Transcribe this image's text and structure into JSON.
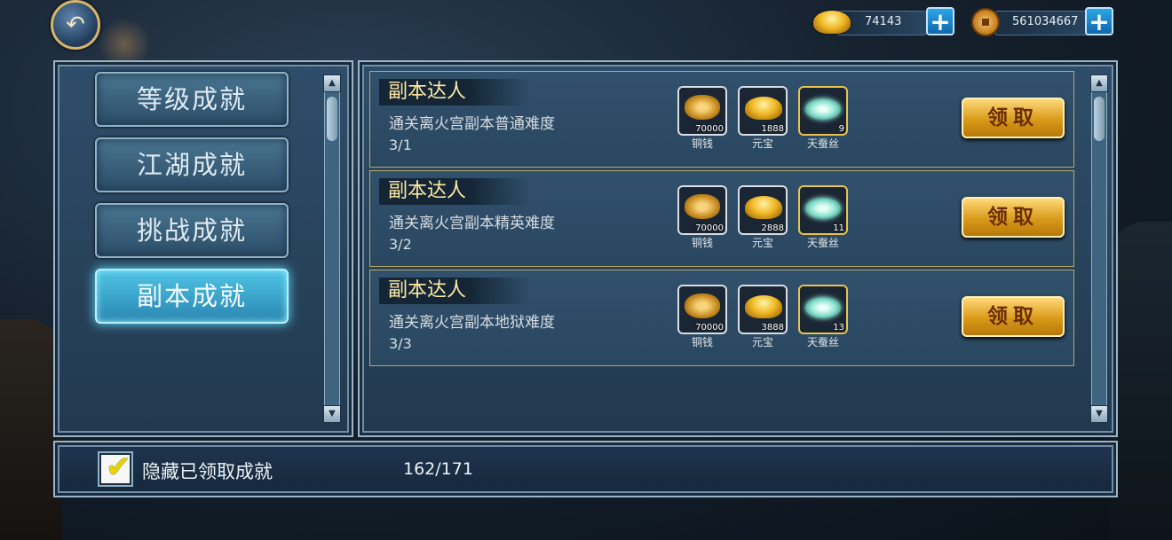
{
  "top_bar": {
    "back_icon": "back-arrow-icon",
    "gold_ingot_value": "74143",
    "copper_value": "561034667",
    "plus_icon": "plus-icon"
  },
  "tabs": [
    {
      "label": "等级成就",
      "active": false
    },
    {
      "label": "江湖成就",
      "active": false
    },
    {
      "label": "挑战成就",
      "active": false
    },
    {
      "label": "副本成就",
      "active": true
    }
  ],
  "achievements": [
    {
      "title": "副本达人",
      "desc": "通关离火宫副本普通难度",
      "progress": "3/1",
      "rewards": [
        {
          "icon": "copper-coins-icon",
          "qty": "70000",
          "name": "铜钱"
        },
        {
          "icon": "gold-ingot-icon",
          "qty": "1888",
          "name": "元宝"
        },
        {
          "icon": "silk-icon",
          "qty": "9",
          "name": "天蚕丝"
        }
      ],
      "button": "领取"
    },
    {
      "title": "副本达人",
      "desc": "通关离火宫副本精英难度",
      "progress": "3/2",
      "rewards": [
        {
          "icon": "copper-coins-icon",
          "qty": "70000",
          "name": "铜钱"
        },
        {
          "icon": "gold-ingot-icon",
          "qty": "2888",
          "name": "元宝"
        },
        {
          "icon": "silk-icon",
          "qty": "11",
          "name": "天蚕丝"
        }
      ],
      "button": "领取"
    },
    {
      "title": "副本达人",
      "desc": "通关离火宫副本地狱难度",
      "progress": "3/3",
      "rewards": [
        {
          "icon": "copper-coins-icon",
          "qty": "70000",
          "name": "铜钱"
        },
        {
          "icon": "gold-ingot-icon",
          "qty": "3888",
          "name": "元宝"
        },
        {
          "icon": "silk-icon",
          "qty": "13",
          "name": "天蚕丝"
        }
      ],
      "button": "领取"
    }
  ],
  "bottom": {
    "hide_claimed_label": "隐藏已领取成就",
    "hide_claimed_checked": true,
    "total_progress": "162/171"
  }
}
